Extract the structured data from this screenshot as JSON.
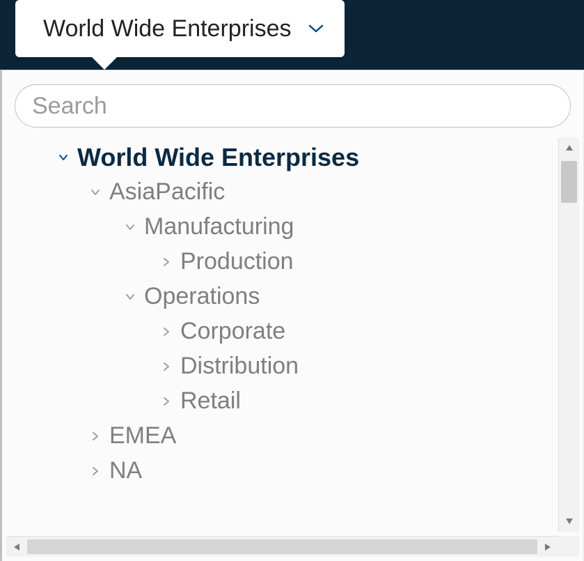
{
  "header": {
    "current_org": "World Wide Enterprises"
  },
  "search": {
    "placeholder": "Search"
  },
  "tree": {
    "root": {
      "label": "World Wide Enterprises",
      "expanded": true
    },
    "asia": {
      "label": "AsiaPacific",
      "expanded": true
    },
    "manu": {
      "label": "Manufacturing",
      "expanded": true
    },
    "prod": {
      "label": "Production",
      "expanded": false
    },
    "ops": {
      "label": "Operations",
      "expanded": true
    },
    "corp": {
      "label": "Corporate",
      "expanded": false
    },
    "dist": {
      "label": "Distribution",
      "expanded": false
    },
    "ret": {
      "label": "Retail",
      "expanded": false
    },
    "emea": {
      "label": "EMEA",
      "expanded": false
    },
    "na": {
      "label": "NA",
      "expanded": false
    }
  }
}
